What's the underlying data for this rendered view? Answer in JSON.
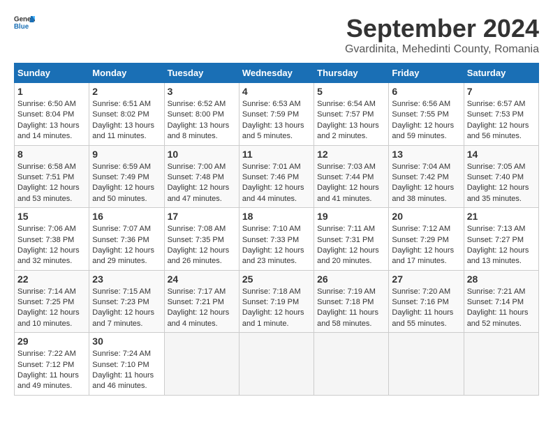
{
  "header": {
    "logo_general": "General",
    "logo_blue": "Blue",
    "title": "September 2024",
    "location": "Gvardinita, Mehedinti County, Romania"
  },
  "weekdays": [
    "Sunday",
    "Monday",
    "Tuesday",
    "Wednesday",
    "Thursday",
    "Friday",
    "Saturday"
  ],
  "weeks": [
    [
      {
        "day": "1",
        "sunrise": "6:50 AM",
        "sunset": "8:04 PM",
        "daylight": "13 hours and 14 minutes."
      },
      {
        "day": "2",
        "sunrise": "6:51 AM",
        "sunset": "8:02 PM",
        "daylight": "13 hours and 11 minutes."
      },
      {
        "day": "3",
        "sunrise": "6:52 AM",
        "sunset": "8:00 PM",
        "daylight": "13 hours and 8 minutes."
      },
      {
        "day": "4",
        "sunrise": "6:53 AM",
        "sunset": "7:59 PM",
        "daylight": "13 hours and 5 minutes."
      },
      {
        "day": "5",
        "sunrise": "6:54 AM",
        "sunset": "7:57 PM",
        "daylight": "13 hours and 2 minutes."
      },
      {
        "day": "6",
        "sunrise": "6:56 AM",
        "sunset": "7:55 PM",
        "daylight": "12 hours and 59 minutes."
      },
      {
        "day": "7",
        "sunrise": "6:57 AM",
        "sunset": "7:53 PM",
        "daylight": "12 hours and 56 minutes."
      }
    ],
    [
      {
        "day": "8",
        "sunrise": "6:58 AM",
        "sunset": "7:51 PM",
        "daylight": "12 hours and 53 minutes."
      },
      {
        "day": "9",
        "sunrise": "6:59 AM",
        "sunset": "7:49 PM",
        "daylight": "12 hours and 50 minutes."
      },
      {
        "day": "10",
        "sunrise": "7:00 AM",
        "sunset": "7:48 PM",
        "daylight": "12 hours and 47 minutes."
      },
      {
        "day": "11",
        "sunrise": "7:01 AM",
        "sunset": "7:46 PM",
        "daylight": "12 hours and 44 minutes."
      },
      {
        "day": "12",
        "sunrise": "7:03 AM",
        "sunset": "7:44 PM",
        "daylight": "12 hours and 41 minutes."
      },
      {
        "day": "13",
        "sunrise": "7:04 AM",
        "sunset": "7:42 PM",
        "daylight": "12 hours and 38 minutes."
      },
      {
        "day": "14",
        "sunrise": "7:05 AM",
        "sunset": "7:40 PM",
        "daylight": "12 hours and 35 minutes."
      }
    ],
    [
      {
        "day": "15",
        "sunrise": "7:06 AM",
        "sunset": "7:38 PM",
        "daylight": "12 hours and 32 minutes."
      },
      {
        "day": "16",
        "sunrise": "7:07 AM",
        "sunset": "7:36 PM",
        "daylight": "12 hours and 29 minutes."
      },
      {
        "day": "17",
        "sunrise": "7:08 AM",
        "sunset": "7:35 PM",
        "daylight": "12 hours and 26 minutes."
      },
      {
        "day": "18",
        "sunrise": "7:10 AM",
        "sunset": "7:33 PM",
        "daylight": "12 hours and 23 minutes."
      },
      {
        "day": "19",
        "sunrise": "7:11 AM",
        "sunset": "7:31 PM",
        "daylight": "12 hours and 20 minutes."
      },
      {
        "day": "20",
        "sunrise": "7:12 AM",
        "sunset": "7:29 PM",
        "daylight": "12 hours and 17 minutes."
      },
      {
        "day": "21",
        "sunrise": "7:13 AM",
        "sunset": "7:27 PM",
        "daylight": "12 hours and 13 minutes."
      }
    ],
    [
      {
        "day": "22",
        "sunrise": "7:14 AM",
        "sunset": "7:25 PM",
        "daylight": "12 hours and 10 minutes."
      },
      {
        "day": "23",
        "sunrise": "7:15 AM",
        "sunset": "7:23 PM",
        "daylight": "12 hours and 7 minutes."
      },
      {
        "day": "24",
        "sunrise": "7:17 AM",
        "sunset": "7:21 PM",
        "daylight": "12 hours and 4 minutes."
      },
      {
        "day": "25",
        "sunrise": "7:18 AM",
        "sunset": "7:19 PM",
        "daylight": "12 hours and 1 minute."
      },
      {
        "day": "26",
        "sunrise": "7:19 AM",
        "sunset": "7:18 PM",
        "daylight": "11 hours and 58 minutes."
      },
      {
        "day": "27",
        "sunrise": "7:20 AM",
        "sunset": "7:16 PM",
        "daylight": "11 hours and 55 minutes."
      },
      {
        "day": "28",
        "sunrise": "7:21 AM",
        "sunset": "7:14 PM",
        "daylight": "11 hours and 52 minutes."
      }
    ],
    [
      {
        "day": "29",
        "sunrise": "7:22 AM",
        "sunset": "7:12 PM",
        "daylight": "11 hours and 49 minutes."
      },
      {
        "day": "30",
        "sunrise": "7:24 AM",
        "sunset": "7:10 PM",
        "daylight": "11 hours and 46 minutes."
      },
      null,
      null,
      null,
      null,
      null
    ]
  ]
}
